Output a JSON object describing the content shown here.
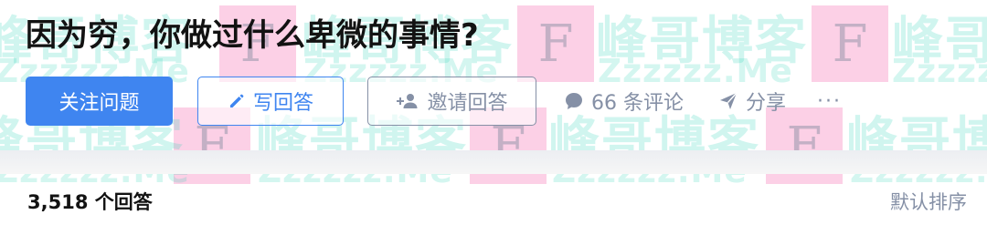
{
  "question": {
    "title": "因为穷，你做过什么卑微的事情?"
  },
  "actions": {
    "follow_label": "关注问题",
    "write_answer_label": "写回答",
    "invite_label": "邀请回答",
    "comments_label": "66 条评论",
    "share_label": "分享",
    "more_label": "···"
  },
  "answers": {
    "count_label": "3,518 个回答",
    "sort_label": "默认排序"
  },
  "watermark": {
    "text": "峰哥博客",
    "url": "Zzzzzz.Me",
    "letter": "F"
  },
  "colors": {
    "accent": "#3f85f0",
    "muted": "#8590a6",
    "text": "#121212"
  },
  "icons": {
    "write": "pencil-icon",
    "invite": "add-user-icon",
    "comment": "comment-bubble-icon",
    "share": "paper-plane-icon",
    "more": "more-dots-icon"
  }
}
